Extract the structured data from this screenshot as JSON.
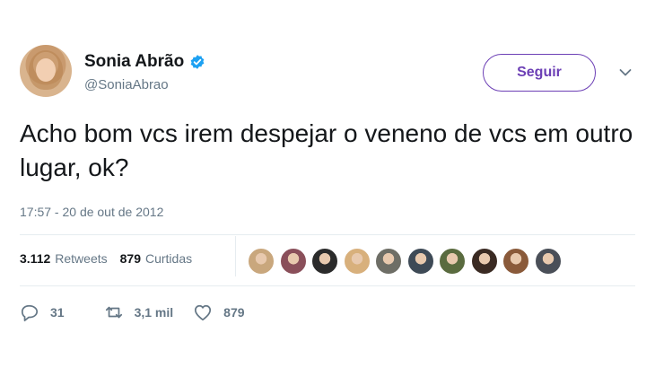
{
  "user": {
    "display_name": "Sonia Abrão",
    "handle": "@SoniaAbrao",
    "verified": true
  },
  "follow_button": {
    "label": "Seguir"
  },
  "tweet": {
    "text": "Acho bom vcs irem despejar o veneno de vcs em outro lugar, ok?",
    "timestamp": "17:57 - 20 de out de 2012"
  },
  "stats": {
    "retweets_count": "3.112",
    "retweets_label": "Retweets",
    "likes_count": "879",
    "likes_label": "Curtidas"
  },
  "liker_avatars": [
    {
      "color": "#c9a77d"
    },
    {
      "color": "#8a4f5a"
    },
    {
      "color": "#2b2b2b"
    },
    {
      "color": "#d8b07c"
    },
    {
      "color": "#6e6e66"
    },
    {
      "color": "#3e4a56"
    },
    {
      "color": "#5a6b3f"
    },
    {
      "color": "#3a2a22"
    },
    {
      "color": "#8a5a3a"
    },
    {
      "color": "#4a4f58"
    }
  ],
  "actions": {
    "replies": "31",
    "retweets": "3,1 mil",
    "likes": "879"
  },
  "colors": {
    "accent": "#6c3fb5",
    "verified": "#1da1f2",
    "secondary_text": "#657786",
    "divider": "#e6ecf0"
  },
  "icons": [
    "verified-badge-icon",
    "chevron-down-icon",
    "reply-icon",
    "retweet-icon",
    "heart-icon"
  ]
}
